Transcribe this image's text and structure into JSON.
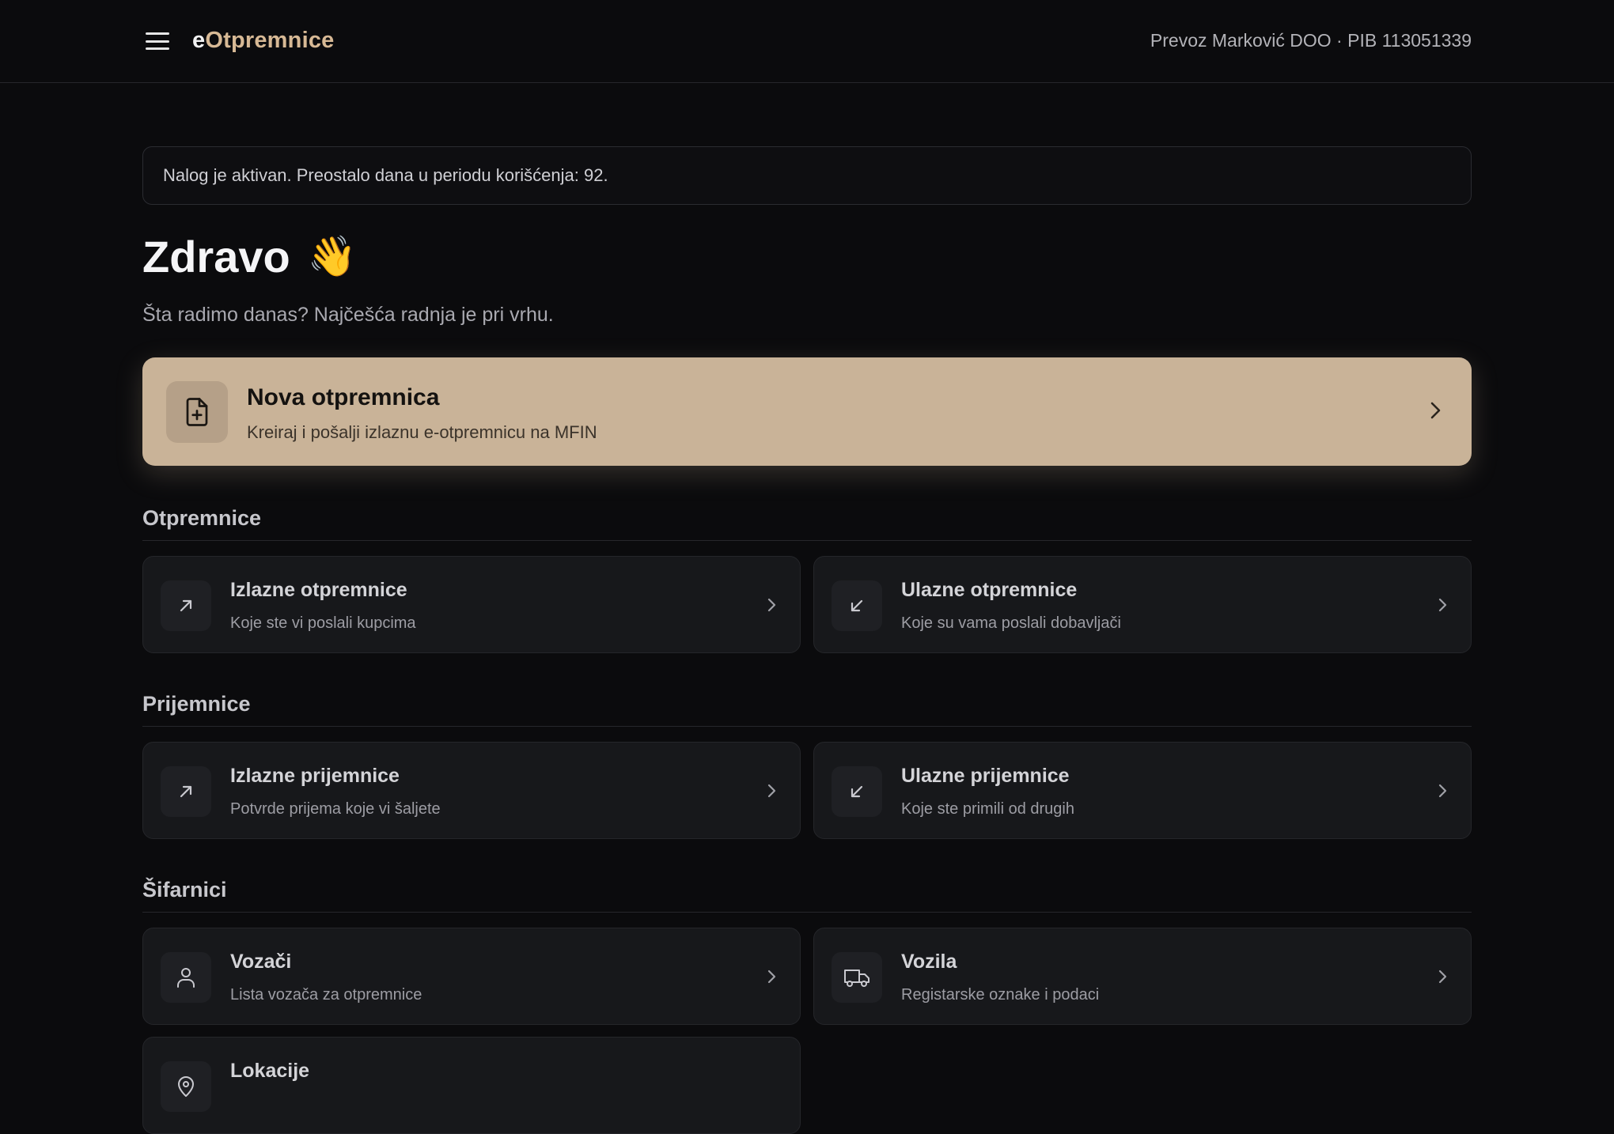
{
  "header": {
    "brand_prefix": "e",
    "brand_rest": "Otpremnice",
    "company": "Prevoz Marković DOO · PIB 113051339"
  },
  "notice": "Nalog je aktivan. Preostalo dana u periodu korišćenja: 92.",
  "greeting": {
    "title": "Zdravo",
    "emoji": "👋",
    "subtitle": "Šta radimo danas? Najčešća radnja je pri vrhu."
  },
  "hero": {
    "title": "Nova otpremnica",
    "description": "Kreiraj i pošalji izlaznu e-otpremnicu na MFIN",
    "icon": "file-plus-icon"
  },
  "sections": {
    "otpremnice": {
      "title": "Otpremnice",
      "cards": [
        {
          "title": "Izlazne otpremnice",
          "description": "Koje ste vi poslali kupcima",
          "icon": "arrow-up-right-icon"
        },
        {
          "title": "Ulazne otpremnice",
          "description": "Koje su vama poslali dobavljači",
          "icon": "arrow-down-left-icon"
        }
      ]
    },
    "prijemnice": {
      "title": "Prijemnice",
      "cards": [
        {
          "title": "Izlazne prijemnice",
          "description": "Potvrde prijema koje vi šaljete",
          "icon": "arrow-up-right-icon"
        },
        {
          "title": "Ulazne prijemnice",
          "description": "Koje ste primili od drugih",
          "icon": "arrow-down-left-icon"
        }
      ]
    },
    "sifarnici": {
      "title": "Šifarnici",
      "cards": [
        {
          "title": "Vozači",
          "description": "Lista vozača za otpremnice",
          "icon": "user-icon"
        },
        {
          "title": "Vozila",
          "description": "Registarske oznake i podaci",
          "icon": "truck-icon"
        },
        {
          "title": "Lokacije",
          "description": "",
          "icon": "map-pin-icon"
        }
      ]
    }
  },
  "colors": {
    "background": "#0b0b0d",
    "accent": "#c9b398",
    "brand": "#d7b995",
    "card": "#17181b"
  }
}
